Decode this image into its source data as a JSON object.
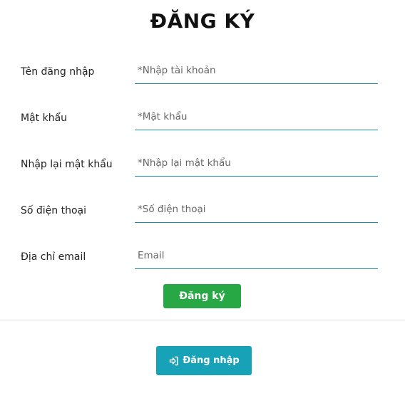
{
  "page": {
    "title": "ĐĂNG KÝ"
  },
  "form": {
    "fields": [
      {
        "label": "Tên đăng nhập",
        "placeholder": "*Nhập tài khoản",
        "value": ""
      },
      {
        "label": "Mật khẩu",
        "placeholder": "*Mật khẩu",
        "value": ""
      },
      {
        "label": "Nhập lại mật khẩu",
        "placeholder": "*Nhập lại mật khẩu",
        "value": ""
      },
      {
        "label": "Số điện thoại",
        "placeholder": "*Số điện thoại",
        "value": ""
      },
      {
        "label": "Địa chỉ email",
        "placeholder": "Email",
        "value": ""
      }
    ],
    "submit_label": "Đăng ký"
  },
  "login": {
    "label": "Đăng nhập",
    "icon": "sign-in-icon"
  },
  "colors": {
    "input_underline": "#1a8fa8",
    "register_button": "#28a745",
    "login_button": "#17a2b8"
  }
}
